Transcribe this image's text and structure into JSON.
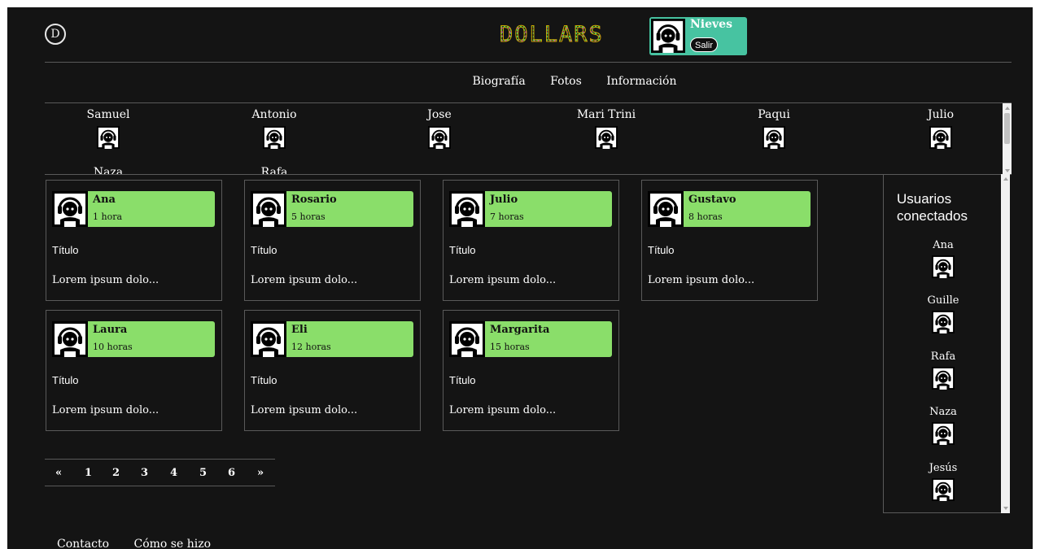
{
  "header": {
    "logo_letter": "D",
    "brand": "DOLLARS",
    "user": {
      "name": "Nieves",
      "logout_label": "Salir",
      "box_color": "#47c3a1"
    }
  },
  "tabs": [
    {
      "label": "Biografía"
    },
    {
      "label": "Fotos"
    },
    {
      "label": "Información"
    }
  ],
  "friends": [
    {
      "name": "Samuel"
    },
    {
      "name": "Antonio"
    },
    {
      "name": "Jose"
    },
    {
      "name": "Mari Trini"
    },
    {
      "name": "Paqui"
    },
    {
      "name": "Julio"
    },
    {
      "name": "Naza"
    },
    {
      "name": "Rafa"
    }
  ],
  "posts": [
    {
      "author": "Ana",
      "time": "1 hora",
      "title": "Título",
      "excerpt": "Lorem ipsum dolo..."
    },
    {
      "author": "Rosario",
      "time": "5 horas",
      "title": "Título",
      "excerpt": "Lorem ipsum dolo..."
    },
    {
      "author": "Julio",
      "time": "7 horas",
      "title": "Título",
      "excerpt": "Lorem ipsum dolo..."
    },
    {
      "author": "Gustavo",
      "time": "8 horas",
      "title": "Título",
      "excerpt": "Lorem ipsum dolo..."
    },
    {
      "author": "Laura",
      "time": "10 horas",
      "title": "Título",
      "excerpt": "Lorem ipsum dolo..."
    },
    {
      "author": "Eli",
      "time": "12 horas",
      "title": "Título",
      "excerpt": "Lorem ipsum dolo..."
    },
    {
      "author": "Margarita",
      "time": "15 horas",
      "title": "Título",
      "excerpt": "Lorem ipsum dolo..."
    }
  ],
  "post_header_color": "#8ade6a",
  "pagination": {
    "prev": "«",
    "pages": [
      "1",
      "2",
      "3",
      "4",
      "5",
      "6"
    ],
    "next": "»"
  },
  "online": {
    "title_line1": "Usuarios",
    "title_line2": "conectados",
    "users": [
      {
        "name": "Ana"
      },
      {
        "name": "Guille"
      },
      {
        "name": "Rafa"
      },
      {
        "name": "Naza"
      },
      {
        "name": "Jesús"
      }
    ]
  },
  "footer": {
    "links": [
      {
        "label": "Contacto"
      },
      {
        "label": "Cómo se hizo"
      }
    ]
  },
  "icons": {
    "avatar": "user-headphones-icon",
    "logo": "dollars-logo-icon"
  }
}
